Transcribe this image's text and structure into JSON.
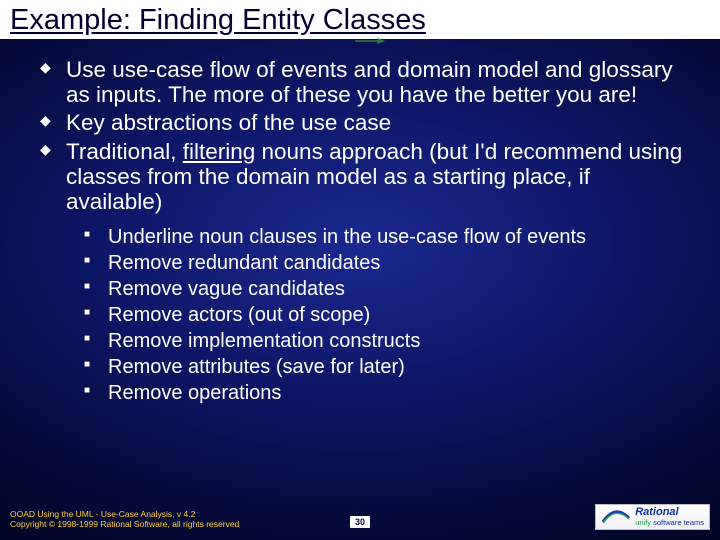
{
  "title": "Example: Finding Entity Classes",
  "bullets_level1": [
    "Use use-case flow of events and domain model and glossary as inputs.  The more of these you have the better you are!",
    "Key abstractions of the use case",
    "Traditional, filtering nouns approach (but I'd recommend using classes from the domain model as a starting place, if available)"
  ],
  "filtering_word": "filtering",
  "bullets_level2": [
    "Underline noun clauses in the use-case flow of events",
    "Remove redundant candidates",
    "Remove vague candidates",
    "Remove actors (out of scope)",
    "Remove implementation constructs",
    "Remove attributes (save for later)",
    "Remove operations"
  ],
  "footer": {
    "line1": "OOAD Using the UML - Use-Case Analysis, v 4.2",
    "line2": "Copyright © 1998-1999 Rational Software, all rights reserved",
    "page": "30",
    "logo_brand": "Rational",
    "logo_tag": "unify",
    "logo_tag2": "software teams"
  }
}
